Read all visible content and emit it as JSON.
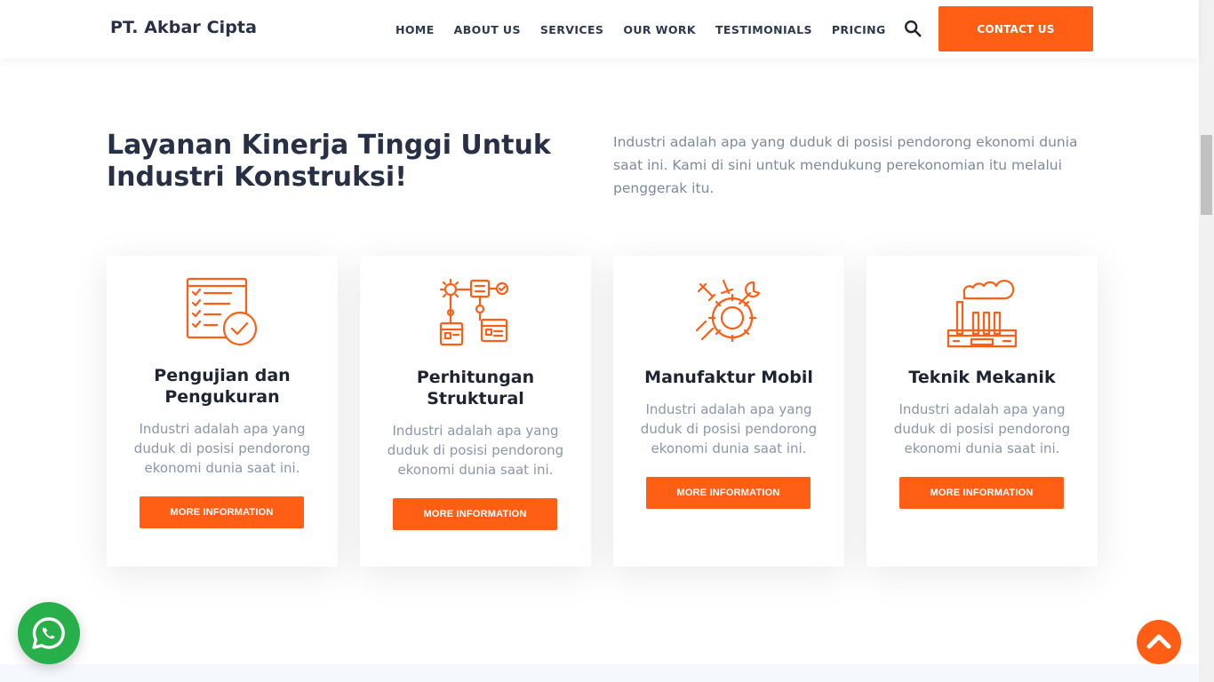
{
  "brand": "PT. Akbar Cipta",
  "nav": {
    "items": [
      "HOME",
      "ABOUT US",
      "SERVICES",
      "OUR WORK",
      "TESTIMONIALS",
      "PRICING"
    ],
    "contact_label": "CONTACT US"
  },
  "intro": {
    "title": "Layanan Kinerja Tinggi Untuk Industri Konstruksi!",
    "description": "Industri adalah apa yang duduk di posisi pendorong ekonomi dunia saat ini. Kami di sini untuk mendukung perekonomian itu melalui penggerak itu."
  },
  "services": [
    {
      "title": "Pengujian dan Pengukuran",
      "text": "Industri adalah apa yang duduk di posisi pendorong ekonomi dunia saat ini.",
      "button": "MORE INFORMATION",
      "icon": "checklist-icon"
    },
    {
      "title": "Perhitungan Struktural",
      "text": "Industri adalah apa yang duduk di posisi pendorong ekonomi dunia saat ini.",
      "button": "MORE INFORMATION",
      "icon": "flowchart-icon"
    },
    {
      "title": "Manufaktur Mobil",
      "text": "Industri adalah apa yang duduk di posisi pendorong ekonomi dunia saat ini.",
      "button": "MORE INFORMATION",
      "icon": "gear-tools-icon"
    },
    {
      "title": "Teknik Mekanik",
      "text": "Industri adalah apa yang duduk di posisi pendorong ekonomi dunia saat ini.",
      "button": "MORE INFORMATION",
      "icon": "factory-icon"
    }
  ],
  "colors": {
    "accent": "#ff5e14",
    "heading": "#273044",
    "muted": "#8a97a8",
    "whatsapp": "#27b04a"
  }
}
